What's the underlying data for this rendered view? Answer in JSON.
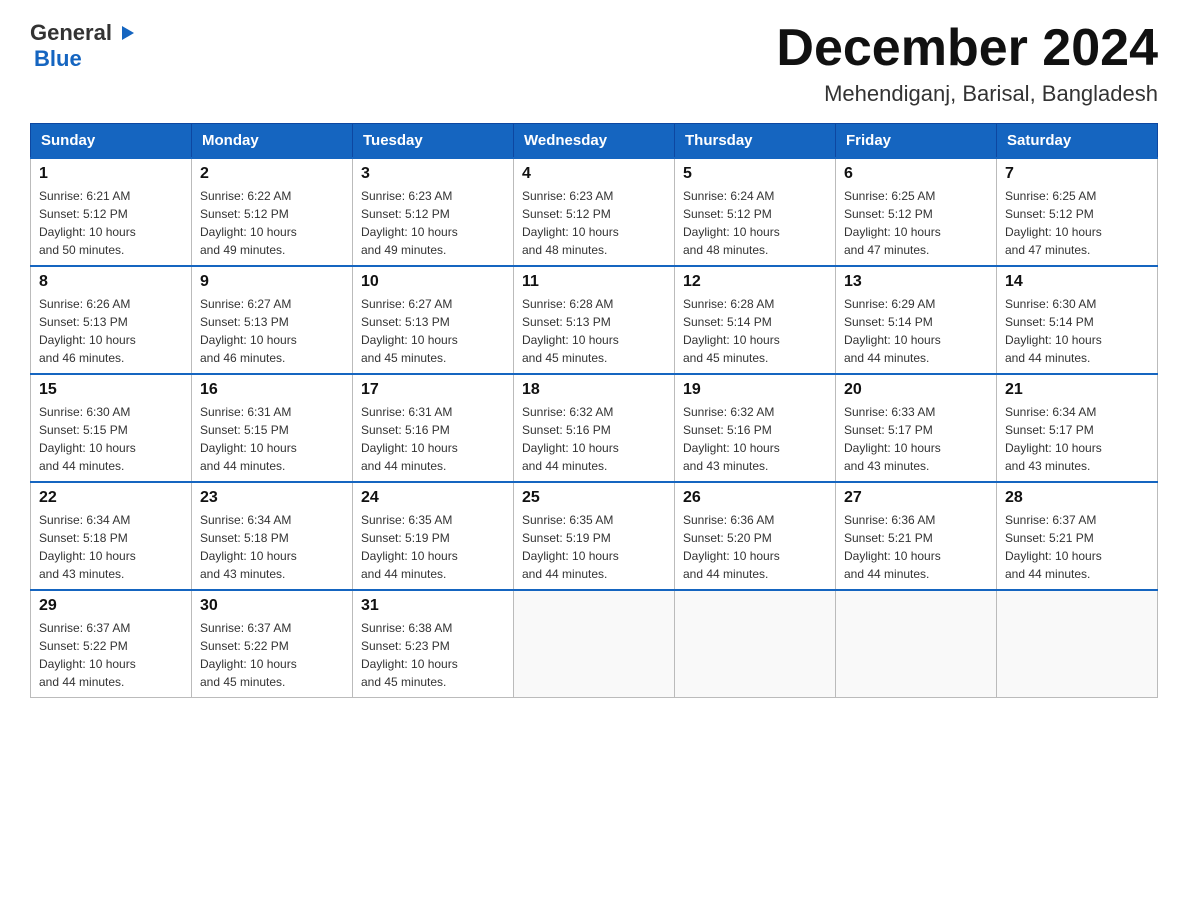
{
  "logo": {
    "line1": "General",
    "triangle": "▶",
    "line2": "Blue"
  },
  "title": "December 2024",
  "subtitle": "Mehendiganj, Barisal, Bangladesh",
  "days_of_week": [
    "Sunday",
    "Monday",
    "Tuesday",
    "Wednesday",
    "Thursday",
    "Friday",
    "Saturday"
  ],
  "weeks": [
    [
      {
        "day": "1",
        "sunrise": "6:21 AM",
        "sunset": "5:12 PM",
        "daylight": "10 hours and 50 minutes."
      },
      {
        "day": "2",
        "sunrise": "6:22 AM",
        "sunset": "5:12 PM",
        "daylight": "10 hours and 49 minutes."
      },
      {
        "day": "3",
        "sunrise": "6:23 AM",
        "sunset": "5:12 PM",
        "daylight": "10 hours and 49 minutes."
      },
      {
        "day": "4",
        "sunrise": "6:23 AM",
        "sunset": "5:12 PM",
        "daylight": "10 hours and 48 minutes."
      },
      {
        "day": "5",
        "sunrise": "6:24 AM",
        "sunset": "5:12 PM",
        "daylight": "10 hours and 48 minutes."
      },
      {
        "day": "6",
        "sunrise": "6:25 AM",
        "sunset": "5:12 PM",
        "daylight": "10 hours and 47 minutes."
      },
      {
        "day": "7",
        "sunrise": "6:25 AM",
        "sunset": "5:12 PM",
        "daylight": "10 hours and 47 minutes."
      }
    ],
    [
      {
        "day": "8",
        "sunrise": "6:26 AM",
        "sunset": "5:13 PM",
        "daylight": "10 hours and 46 minutes."
      },
      {
        "day": "9",
        "sunrise": "6:27 AM",
        "sunset": "5:13 PM",
        "daylight": "10 hours and 46 minutes."
      },
      {
        "day": "10",
        "sunrise": "6:27 AM",
        "sunset": "5:13 PM",
        "daylight": "10 hours and 45 minutes."
      },
      {
        "day": "11",
        "sunrise": "6:28 AM",
        "sunset": "5:13 PM",
        "daylight": "10 hours and 45 minutes."
      },
      {
        "day": "12",
        "sunrise": "6:28 AM",
        "sunset": "5:14 PM",
        "daylight": "10 hours and 45 minutes."
      },
      {
        "day": "13",
        "sunrise": "6:29 AM",
        "sunset": "5:14 PM",
        "daylight": "10 hours and 44 minutes."
      },
      {
        "day": "14",
        "sunrise": "6:30 AM",
        "sunset": "5:14 PM",
        "daylight": "10 hours and 44 minutes."
      }
    ],
    [
      {
        "day": "15",
        "sunrise": "6:30 AM",
        "sunset": "5:15 PM",
        "daylight": "10 hours and 44 minutes."
      },
      {
        "day": "16",
        "sunrise": "6:31 AM",
        "sunset": "5:15 PM",
        "daylight": "10 hours and 44 minutes."
      },
      {
        "day": "17",
        "sunrise": "6:31 AM",
        "sunset": "5:16 PM",
        "daylight": "10 hours and 44 minutes."
      },
      {
        "day": "18",
        "sunrise": "6:32 AM",
        "sunset": "5:16 PM",
        "daylight": "10 hours and 44 minutes."
      },
      {
        "day": "19",
        "sunrise": "6:32 AM",
        "sunset": "5:16 PM",
        "daylight": "10 hours and 43 minutes."
      },
      {
        "day": "20",
        "sunrise": "6:33 AM",
        "sunset": "5:17 PM",
        "daylight": "10 hours and 43 minutes."
      },
      {
        "day": "21",
        "sunrise": "6:34 AM",
        "sunset": "5:17 PM",
        "daylight": "10 hours and 43 minutes."
      }
    ],
    [
      {
        "day": "22",
        "sunrise": "6:34 AM",
        "sunset": "5:18 PM",
        "daylight": "10 hours and 43 minutes."
      },
      {
        "day": "23",
        "sunrise": "6:34 AM",
        "sunset": "5:18 PM",
        "daylight": "10 hours and 43 minutes."
      },
      {
        "day": "24",
        "sunrise": "6:35 AM",
        "sunset": "5:19 PM",
        "daylight": "10 hours and 44 minutes."
      },
      {
        "day": "25",
        "sunrise": "6:35 AM",
        "sunset": "5:19 PM",
        "daylight": "10 hours and 44 minutes."
      },
      {
        "day": "26",
        "sunrise": "6:36 AM",
        "sunset": "5:20 PM",
        "daylight": "10 hours and 44 minutes."
      },
      {
        "day": "27",
        "sunrise": "6:36 AM",
        "sunset": "5:21 PM",
        "daylight": "10 hours and 44 minutes."
      },
      {
        "day": "28",
        "sunrise": "6:37 AM",
        "sunset": "5:21 PM",
        "daylight": "10 hours and 44 minutes."
      }
    ],
    [
      {
        "day": "29",
        "sunrise": "6:37 AM",
        "sunset": "5:22 PM",
        "daylight": "10 hours and 44 minutes."
      },
      {
        "day": "30",
        "sunrise": "6:37 AM",
        "sunset": "5:22 PM",
        "daylight": "10 hours and 45 minutes."
      },
      {
        "day": "31",
        "sunrise": "6:38 AM",
        "sunset": "5:23 PM",
        "daylight": "10 hours and 45 minutes."
      },
      null,
      null,
      null,
      null
    ]
  ]
}
